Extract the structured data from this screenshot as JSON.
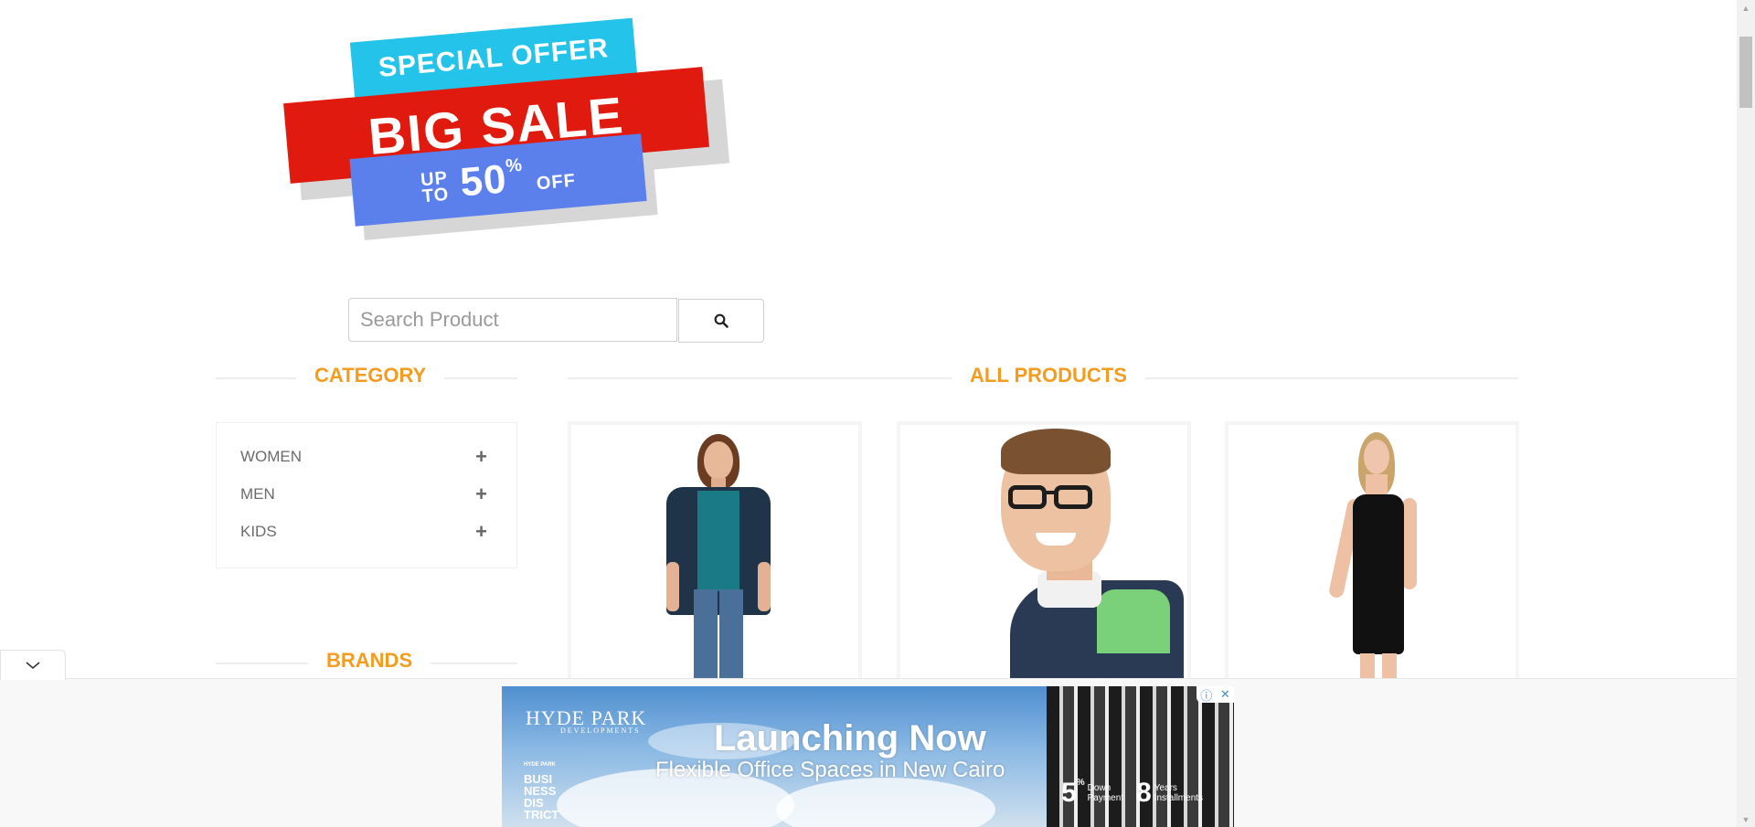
{
  "logo": {
    "line1": "SPECIAL OFFER",
    "line2": "BIG SALE",
    "line3_prefix_top": "UP",
    "line3_prefix_bottom": "TO",
    "line3_number": "50",
    "line3_percent": "%",
    "line3_suffix": "OFF"
  },
  "search": {
    "placeholder": "Search Product",
    "button_icon": "search-icon"
  },
  "category": {
    "title": "CATEGORY",
    "items": [
      {
        "label": "WOMEN",
        "icon": "plus-icon"
      },
      {
        "label": "MEN",
        "icon": "plus-icon"
      },
      {
        "label": "KIDS",
        "icon": "plus-icon"
      }
    ]
  },
  "brands": {
    "title": "BRANDS"
  },
  "products": {
    "title": "ALL PRODUCTS"
  },
  "ad": {
    "brand": "HYDE PARK",
    "brand_sub": "DEVELOPMENTS",
    "headline": "Launching Now",
    "subline": "Flexible Office Spaces in New Cairo",
    "biz_logo_top": "HYDE PARK",
    "biz_logo": [
      "BUSI",
      "NESS",
      "DIS",
      "TRICT"
    ],
    "stat1_value": "5",
    "stat1_unit": "%",
    "stat1_label": [
      "Down",
      "Payment"
    ],
    "stat2_value": "8",
    "stat2_label": [
      "Years",
      "Installments"
    ],
    "info_icon": "ⓘ",
    "close_icon": "✕"
  },
  "colors": {
    "accent": "#f39c1f",
    "banner_red": "#e01a0f",
    "banner_cyan": "#24c3ea",
    "banner_blue": "#5b80ec"
  }
}
